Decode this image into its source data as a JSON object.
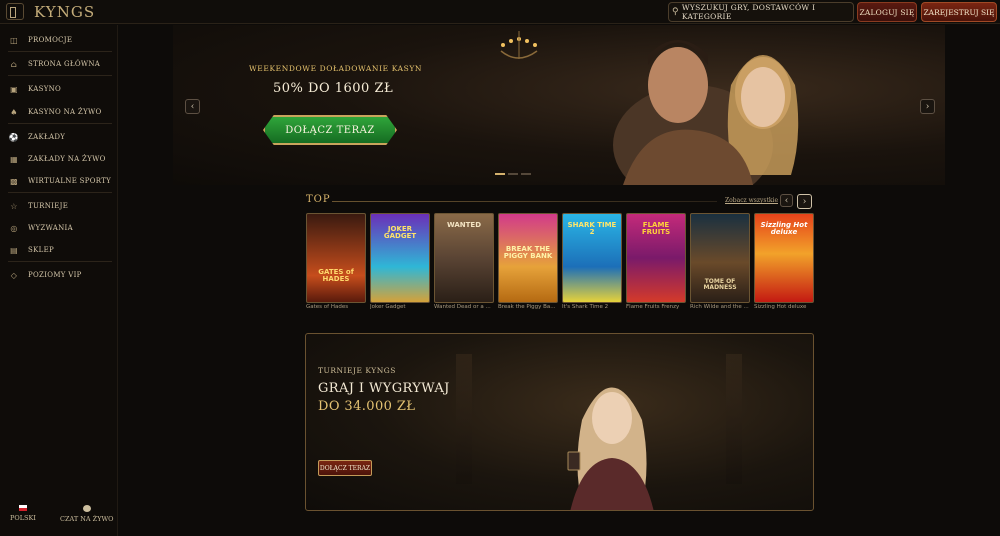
{
  "header": {
    "logo": "KYNGS",
    "search_text": "WYSZUKUJ GRY, DOSTAWCÓW I KATEGORIE",
    "login": "ZALOGUJ SIĘ",
    "register": "ZAREJESTRUJ SIĘ"
  },
  "sidebar": {
    "items": [
      {
        "label": "PROMOCJE",
        "icon": "gift-icon"
      },
      {
        "label": "STRONA GŁÓWNA",
        "icon": "home-icon"
      },
      {
        "label": "KASYNO",
        "icon": "slot-icon"
      },
      {
        "label": "KASYNO NA ŻYWO",
        "icon": "dealer-icon"
      },
      {
        "label": "ZAKŁADY",
        "icon": "ball-icon"
      },
      {
        "label": "ZAKŁADY NA ŻYWO",
        "icon": "live-bet-icon"
      },
      {
        "label": "WIRTUALNE SPORTY",
        "icon": "virtual-icon"
      },
      {
        "label": "TURNIEJE",
        "icon": "trophy-icon"
      },
      {
        "label": "WYZWANIA",
        "icon": "target-icon"
      },
      {
        "label": "SKLEP",
        "icon": "shop-icon"
      },
      {
        "label": "POZIOMY VIP",
        "icon": "diamond-icon"
      }
    ],
    "language": "POLSKI",
    "chat": "CZAT NA ŻYWO"
  },
  "hero": {
    "subtitle": "WEEKENDOWE DOŁADOWANIE KASYN",
    "title": "50% DO 1600 ZŁ",
    "cta": "DOŁĄCZ TERAZ"
  },
  "top": {
    "label": "TOP",
    "see_all": "Zobacz wszystkie",
    "games": [
      {
        "name": "Gates of Hades",
        "art": "GATES of HADES"
      },
      {
        "name": "Joker Gadget",
        "art": "JOKER GADGET"
      },
      {
        "name": "Wanted Dead or a ...",
        "art": "WANTED"
      },
      {
        "name": "Break the Piggy Ba...",
        "art": "BREAK THE PIGGY BANK"
      },
      {
        "name": "It's Shark Time 2",
        "art": "SHARK TIME 2"
      },
      {
        "name": "Flame Fruits Frenzy",
        "art": "FLAME FRUITS"
      },
      {
        "name": "Rich Wilde and the ...",
        "art": "TOME OF MADNESS"
      },
      {
        "name": "Sizzling Hot deluxe",
        "art": "Sizzling Hot deluxe"
      }
    ]
  },
  "promo": {
    "subtitle": "TURNIEJE KYNGS",
    "line1": "GRAJ I WYGRYWAJ",
    "line2": "DO 34.000 ZŁ",
    "cta": "DOŁĄCZ TERAZ"
  },
  "colors": {
    "accent_gold": "#d4b16d",
    "cta_green": "#2fa53a",
    "cta_red": "#7a2612"
  }
}
